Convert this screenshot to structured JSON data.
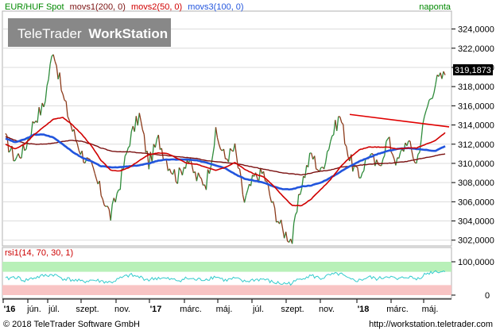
{
  "header": {
    "instrument": "EUR/HUF Spot",
    "ma1": "movs1(200, 0)",
    "ma2": "movs2(50, 0)",
    "ma3": "movs3(100, 0)",
    "period": "naponta"
  },
  "watermark": {
    "brand_light": "TeleTrader",
    "brand_bold": "WorkStation"
  },
  "price_badge": "319,1873",
  "rsi_panel": {
    "label": "rsi1(14, 70, 30, 1)",
    "tick_labels": [
      "100,0000",
      "0"
    ]
  },
  "x_axis": {
    "labels": [
      "'16",
      "jún.",
      "júl.",
      "szept.",
      "nov.",
      "'17",
      "márc.",
      "máj.",
      "júl.",
      "szept.",
      "nov.",
      "'18",
      "márc.",
      "máj."
    ]
  },
  "footer": {
    "copyright": "© 2018 TeleTrader Software GmbH",
    "url": "http://workstation.teletrader.com"
  },
  "colors": {
    "price_up": "#2e8b3a",
    "price_down": "#8b3a1a",
    "ma200": "#7a1010",
    "ma50": "#d00000",
    "ma100": "#2255dd",
    "trendline": "#e00000",
    "rsi_line": "#33cccc",
    "rsi_overbought_band": "#b8f0b8",
    "rsi_oversold_band": "#f8c4c4"
  },
  "chart_data": [
    {
      "type": "line",
      "title": "EUR/HUF Spot",
      "period": "naponta",
      "y_axis_tick_labels": [
        "302,0000",
        "304,0000",
        "306,0000",
        "308,0000",
        "310,0000",
        "312,0000",
        "314,0000",
        "316,0000",
        "318,0000",
        "320,0000",
        "322,0000",
        "324,0000"
      ],
      "ylim": [
        301.4,
        325.7
      ],
      "last_value": 319.1873,
      "x_categories": [
        "'16",
        "jún.",
        "júl.",
        "szept.",
        "nov.",
        "'17",
        "márc.",
        "máj.",
        "júl.",
        "szept.",
        "nov.",
        "'18",
        "márc.",
        "máj."
      ],
      "series": [
        {
          "name": "EUR/HUF Spot",
          "values": [
            312.5,
            310.5,
            311.5,
            314.5,
            316.0,
            322.0,
            317.0,
            313.5,
            311.0,
            309.5,
            307.0,
            304.5,
            308.0,
            312.5,
            315.0,
            310.0,
            312.5,
            310.0,
            308.5,
            310.5,
            308.5,
            308.0,
            313.0,
            310.5,
            311.5,
            306.0,
            308.5,
            309.0,
            305.5,
            303.0,
            302.0,
            308.0,
            311.0,
            309.0,
            312.5,
            315.0,
            310.5,
            308.5,
            311.0,
            309.5,
            312.5,
            310.0,
            312.5,
            310.0,
            315.5,
            318.5,
            319.2
          ]
        },
        {
          "name": "movs1(200, 0)",
          "values": [
            312.8,
            312.4,
            312.1,
            312.0,
            312.0,
            312.1,
            312.3,
            312.4,
            312.3,
            312.0,
            311.6,
            311.3,
            311.2,
            311.2,
            311.1,
            311.0,
            310.9,
            310.8,
            310.7,
            310.6,
            310.5,
            310.3,
            310.2,
            310.1,
            310.0,
            309.8,
            309.6,
            309.4,
            309.2,
            309.0,
            308.9,
            308.8,
            309.0,
            309.2,
            309.3,
            309.6,
            309.7,
            309.8,
            309.9,
            310.0,
            310.0,
            310.1,
            310.2,
            310.4,
            310.6,
            310.8,
            311.0
          ]
        },
        {
          "name": "movs2(50, 0)",
          "values": [
            312.0,
            311.5,
            312.0,
            313.0,
            313.8,
            314.6,
            314.8,
            314.0,
            313.0,
            311.8,
            310.3,
            309.3,
            309.2,
            309.6,
            310.3,
            310.9,
            311.1,
            311.0,
            310.5,
            310.0,
            309.9,
            309.6,
            309.3,
            309.6,
            310.1,
            309.4,
            308.9,
            308.6,
            307.7,
            306.6,
            305.6,
            305.6,
            306.3,
            307.3,
            308.3,
            309.6,
            310.6,
            311.4,
            311.7,
            311.7,
            311.7,
            311.5,
            311.6,
            311.6,
            312.0,
            312.4,
            313.2
          ]
        },
        {
          "name": "movs3(100, 0)",
          "values": [
            312.6,
            312.2,
            312.5,
            313.0,
            313.0,
            312.7,
            312.0,
            311.2,
            310.6,
            310.2,
            309.7,
            309.6,
            309.6,
            309.7,
            309.8,
            310.0,
            310.3,
            310.4,
            310.4,
            310.4,
            310.3,
            310.1,
            309.8,
            309.5,
            308.9,
            308.4,
            308.2,
            308.0,
            307.6,
            307.3,
            307.3,
            307.6,
            307.7,
            308.0,
            308.5,
            309.1,
            309.7,
            310.2,
            310.6,
            311.0,
            311.3,
            311.5,
            311.6,
            311.5,
            311.4,
            311.3,
            311.8
          ]
        },
        {
          "name": "trendline",
          "values": [
            315.1,
            313.8
          ]
        }
      ]
    },
    {
      "type": "line",
      "title": "rsi1(14, 70, 30, 1)",
      "ylim": [
        0,
        100
      ],
      "bands": {
        "overbought": 70,
        "oversold": 30
      },
      "series": [
        {
          "name": "rsi1(14, 70, 30, 1)",
          "values": [
            48,
            55,
            44,
            52,
            58,
            62,
            50,
            46,
            40,
            45,
            42,
            38,
            50,
            60,
            54,
            46,
            52,
            48,
            44,
            50,
            46,
            48,
            56,
            44,
            50,
            40,
            46,
            48,
            38,
            34,
            36,
            52,
            58,
            50,
            60,
            64,
            46,
            44,
            54,
            48,
            58,
            46,
            56,
            48,
            64,
            72,
            70
          ]
        }
      ]
    }
  ]
}
